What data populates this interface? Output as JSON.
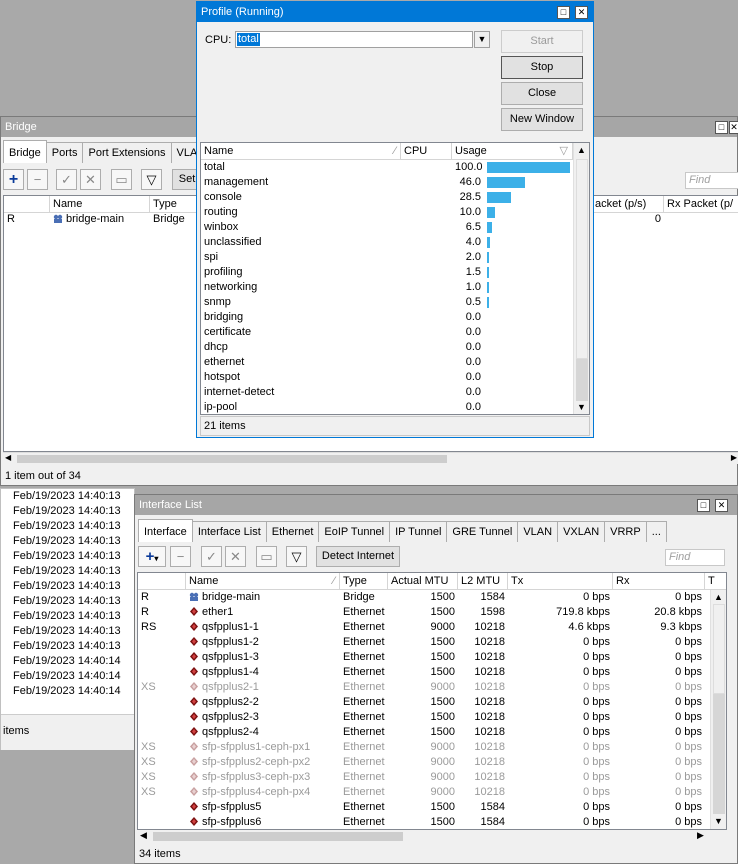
{
  "bridge_window": {
    "title": "Bridge",
    "tabs": [
      "Bridge",
      "Ports",
      "Port Extensions",
      "VLA"
    ],
    "toolbar_set": "Set",
    "find_placeholder": "Find",
    "columns": {
      "name": "Name",
      "type": "Type",
      "tx_packet": "acket (p/s)",
      "rx_packet": "Rx Packet (p/"
    },
    "row": {
      "flag": "R",
      "name": "bridge-main",
      "type": "Bridge",
      "tx": "0"
    },
    "status": "1 item out of 34"
  },
  "log": {
    "entries": [
      "Feb/19/2023 14:40:13",
      "Feb/19/2023 14:40:13",
      "Feb/19/2023 14:40:13",
      "Feb/19/2023 14:40:13",
      "Feb/19/2023 14:40:13",
      "Feb/19/2023 14:40:13",
      "Feb/19/2023 14:40:13",
      "Feb/19/2023 14:40:13",
      "Feb/19/2023 14:40:13",
      "Feb/19/2023 14:40:13",
      "Feb/19/2023 14:40:13",
      "Feb/19/2023 14:40:14",
      "Feb/19/2023 14:40:14",
      "Feb/19/2023 14:40:14"
    ],
    "status": "items"
  },
  "profile": {
    "title": "Profile (Running)",
    "cpu_label": "CPU:",
    "cpu_value": "total",
    "buttons": {
      "start": "Start",
      "stop": "Stop",
      "close": "Close",
      "new_window": "New Window"
    },
    "columns": {
      "name": "Name",
      "cpu": "CPU",
      "usage": "Usage"
    },
    "rows": [
      {
        "name": "total",
        "usage": "100.0",
        "pct": 100
      },
      {
        "name": "management",
        "usage": "46.0",
        "pct": 46
      },
      {
        "name": "console",
        "usage": "28.5",
        "pct": 28.5
      },
      {
        "name": "routing",
        "usage": "10.0",
        "pct": 10
      },
      {
        "name": "winbox",
        "usage": "6.5",
        "pct": 6.5
      },
      {
        "name": "unclassified",
        "usage": "4.0",
        "pct": 4
      },
      {
        "name": "spi",
        "usage": "2.0",
        "pct": 2
      },
      {
        "name": "profiling",
        "usage": "1.5",
        "pct": 1.5
      },
      {
        "name": "networking",
        "usage": "1.0",
        "pct": 1
      },
      {
        "name": "snmp",
        "usage": "0.5",
        "pct": 0.5
      },
      {
        "name": "bridging",
        "usage": "0.0",
        "pct": 0
      },
      {
        "name": "certificate",
        "usage": "0.0",
        "pct": 0
      },
      {
        "name": "dhcp",
        "usage": "0.0",
        "pct": 0
      },
      {
        "name": "ethernet",
        "usage": "0.0",
        "pct": 0
      },
      {
        "name": "hotspot",
        "usage": "0.0",
        "pct": 0
      },
      {
        "name": "internet-detect",
        "usage": "0.0",
        "pct": 0
      },
      {
        "name": "ip-pool",
        "usage": "0.0",
        "pct": 0
      }
    ],
    "status": "21 items"
  },
  "interfaces": {
    "title": "Interface List",
    "tabs": [
      "Interface",
      "Interface List",
      "Ethernet",
      "EoIP Tunnel",
      "IP Tunnel",
      "GRE Tunnel",
      "VLAN",
      "VXLAN",
      "VRRP",
      "..."
    ],
    "detect_button": "Detect Internet",
    "find_placeholder": "Find",
    "columns": {
      "name": "Name",
      "type": "Type",
      "mtu": "Actual MTU",
      "l2mtu": "L2 MTU",
      "tx": "Tx",
      "rx": "Rx",
      "t": "T"
    },
    "rows": [
      {
        "flag": "R",
        "name": "bridge-main",
        "type": "Bridge",
        "mtu": "1500",
        "l2mtu": "1584",
        "tx": "0 bps",
        "rx": "0 bps",
        "kind": "bridge",
        "disabled": false
      },
      {
        "flag": "R",
        "name": "ether1",
        "type": "Ethernet",
        "mtu": "1500",
        "l2mtu": "1598",
        "tx": "719.8 kbps",
        "rx": "20.8 kbps",
        "kind": "eth",
        "disabled": false
      },
      {
        "flag": "RS",
        "name": "qsfpplus1-1",
        "type": "Ethernet",
        "mtu": "9000",
        "l2mtu": "10218",
        "tx": "4.6 kbps",
        "rx": "9.3 kbps",
        "kind": "eth",
        "disabled": false
      },
      {
        "flag": "",
        "name": "qsfpplus1-2",
        "type": "Ethernet",
        "mtu": "1500",
        "l2mtu": "10218",
        "tx": "0 bps",
        "rx": "0 bps",
        "kind": "eth",
        "disabled": false
      },
      {
        "flag": "",
        "name": "qsfpplus1-3",
        "type": "Ethernet",
        "mtu": "1500",
        "l2mtu": "10218",
        "tx": "0 bps",
        "rx": "0 bps",
        "kind": "eth",
        "disabled": false
      },
      {
        "flag": "",
        "name": "qsfpplus1-4",
        "type": "Ethernet",
        "mtu": "1500",
        "l2mtu": "10218",
        "tx": "0 bps",
        "rx": "0 bps",
        "kind": "eth",
        "disabled": false
      },
      {
        "flag": "XS",
        "name": "qsfpplus2-1",
        "type": "Ethernet",
        "mtu": "9000",
        "l2mtu": "10218",
        "tx": "0 bps",
        "rx": "0 bps",
        "kind": "eth",
        "disabled": true
      },
      {
        "flag": "",
        "name": "qsfpplus2-2",
        "type": "Ethernet",
        "mtu": "1500",
        "l2mtu": "10218",
        "tx": "0 bps",
        "rx": "0 bps",
        "kind": "eth",
        "disabled": false
      },
      {
        "flag": "",
        "name": "qsfpplus2-3",
        "type": "Ethernet",
        "mtu": "1500",
        "l2mtu": "10218",
        "tx": "0 bps",
        "rx": "0 bps",
        "kind": "eth",
        "disabled": false
      },
      {
        "flag": "",
        "name": "qsfpplus2-4",
        "type": "Ethernet",
        "mtu": "1500",
        "l2mtu": "10218",
        "tx": "0 bps",
        "rx": "0 bps",
        "kind": "eth",
        "disabled": false
      },
      {
        "flag": "XS",
        "name": "sfp-sfpplus1-ceph-px1",
        "type": "Ethernet",
        "mtu": "9000",
        "l2mtu": "10218",
        "tx": "0 bps",
        "rx": "0 bps",
        "kind": "eth",
        "disabled": true
      },
      {
        "flag": "XS",
        "name": "sfp-sfpplus2-ceph-px2",
        "type": "Ethernet",
        "mtu": "9000",
        "l2mtu": "10218",
        "tx": "0 bps",
        "rx": "0 bps",
        "kind": "eth",
        "disabled": true
      },
      {
        "flag": "XS",
        "name": "sfp-sfpplus3-ceph-px3",
        "type": "Ethernet",
        "mtu": "9000",
        "l2mtu": "10218",
        "tx": "0 bps",
        "rx": "0 bps",
        "kind": "eth",
        "disabled": true
      },
      {
        "flag": "XS",
        "name": "sfp-sfpplus4-ceph-px4",
        "type": "Ethernet",
        "mtu": "9000",
        "l2mtu": "10218",
        "tx": "0 bps",
        "rx": "0 bps",
        "kind": "eth",
        "disabled": true
      },
      {
        "flag": "",
        "name": "sfp-sfpplus5",
        "type": "Ethernet",
        "mtu": "1500",
        "l2mtu": "1584",
        "tx": "0 bps",
        "rx": "0 bps",
        "kind": "eth",
        "disabled": false
      },
      {
        "flag": "",
        "name": "sfp-sfpplus6",
        "type": "Ethernet",
        "mtu": "1500",
        "l2mtu": "1584",
        "tx": "0 bps",
        "rx": "0 bps",
        "kind": "eth",
        "disabled": false
      }
    ],
    "status": "34 items"
  },
  "colors": {
    "usage_bar": "#3cb0e8",
    "title_active": "#0078d7",
    "title_inactive": "#a6a6a6"
  }
}
